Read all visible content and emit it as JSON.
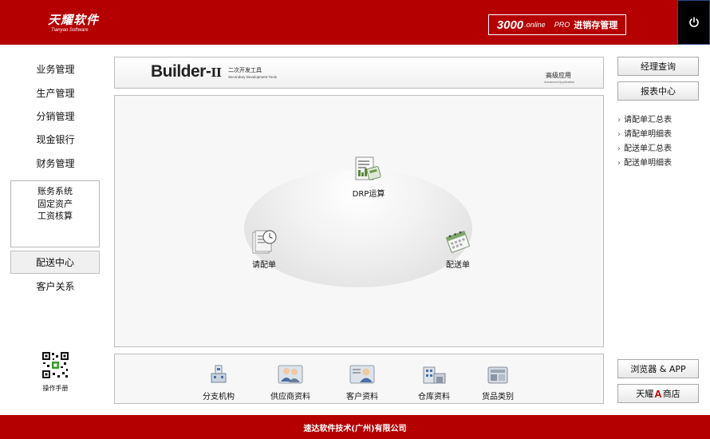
{
  "header": {
    "logo_main": "天耀软件",
    "logo_sub": "Tianyao Software",
    "product_num": "3000",
    "product_online": ".online",
    "product_pro": "PRO",
    "product_name": "进销存管理",
    "power_icon": "power-icon"
  },
  "sidebar": {
    "items": [
      {
        "label": "业务管理"
      },
      {
        "label": "生产管理"
      },
      {
        "label": "分销管理"
      },
      {
        "label": "现金银行"
      },
      {
        "label": "财务管理"
      }
    ],
    "sub_items": [
      {
        "label": "账务系统"
      },
      {
        "label": "固定资产"
      },
      {
        "label": "工资核算"
      }
    ],
    "active_label": "配送中心",
    "customer_label": "客户关系",
    "manual_label": "操作手册"
  },
  "banner": {
    "title_main": "Builder-",
    "title_numeral": "II",
    "cn_subtitle": "二次开发工具",
    "en_subtitle": "Secondary Development Tools",
    "advanced_label": "高级应用",
    "advanced_en": "Advanced Application"
  },
  "flow": {
    "drp_label": "DRP运算",
    "request_label": "请配单",
    "delivery_label": "配送单"
  },
  "toolbar": {
    "items": [
      {
        "label": "分支机构"
      },
      {
        "label": "供应商资料"
      },
      {
        "label": "客户资料"
      },
      {
        "label": "仓库资料"
      },
      {
        "label": "货品类别"
      }
    ]
  },
  "right": {
    "manager_query": "经理查询",
    "report_center": "报表中心",
    "reports": [
      {
        "label": "请配单汇总表"
      },
      {
        "label": "请配单明细表"
      },
      {
        "label": "配送单汇总表"
      },
      {
        "label": "配送单明细表"
      }
    ],
    "browser_app": "浏览器 & APP",
    "store_prefix": "天耀",
    "store_letter": "A",
    "store_suffix": "商店"
  },
  "footer": {
    "company": "速达软件技术(广州)有限公司"
  },
  "colors": {
    "brand_red": "#b40000",
    "store_a_red": "#c00000"
  }
}
